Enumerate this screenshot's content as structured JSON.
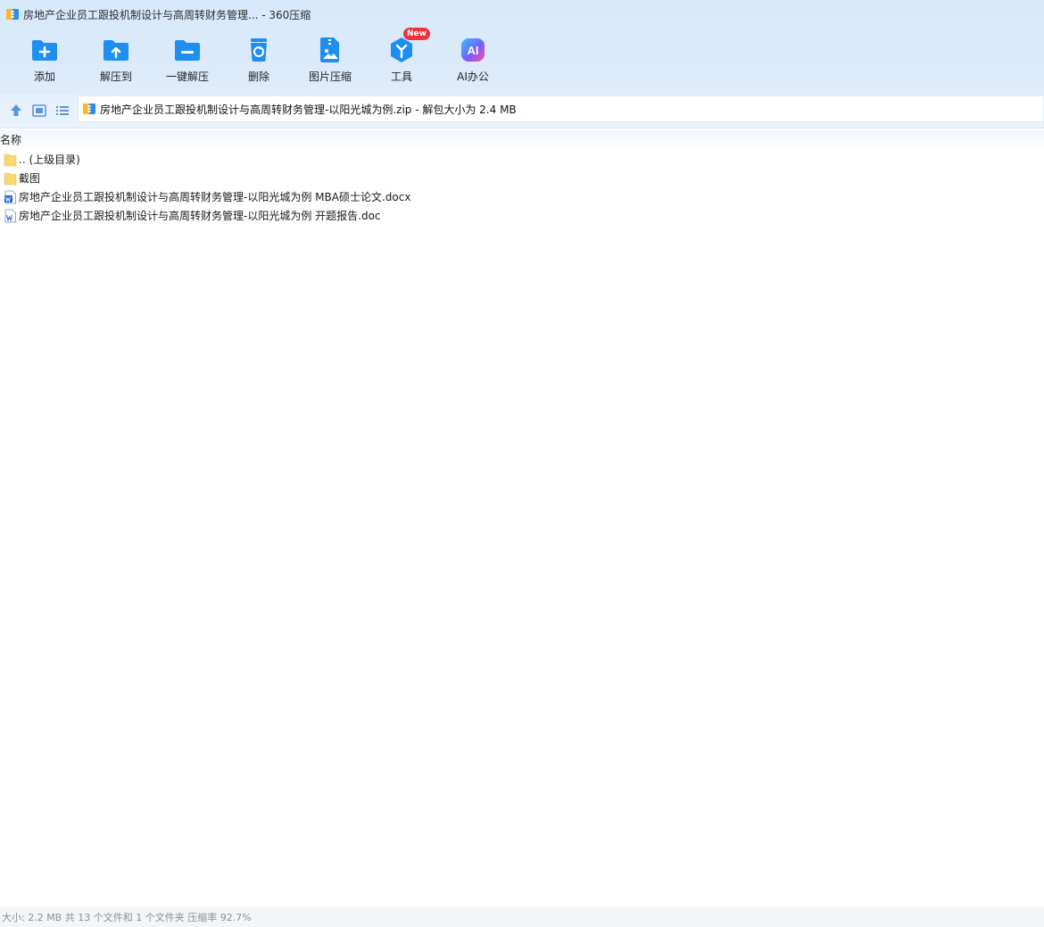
{
  "window": {
    "title": "房地产企业员工跟投机制设计与高周转财务管理... - 360压缩",
    "app_icon": "archive-app-icon"
  },
  "toolbar": {
    "items": [
      {
        "label": "添加",
        "icon": "add-icon"
      },
      {
        "label": "解压到",
        "icon": "extract-to-icon"
      },
      {
        "label": "一键解压",
        "icon": "one-click-extract-icon"
      },
      {
        "label": "删除",
        "icon": "delete-icon"
      },
      {
        "label": "图片压缩",
        "icon": "image-compress-icon"
      },
      {
        "label": "工具",
        "icon": "tools-icon",
        "badge": "New"
      },
      {
        "label": "AI办公",
        "icon": "ai-office-icon",
        "glyph": "AI"
      }
    ]
  },
  "address": {
    "path": "房地产企业员工跟投机制设计与高周转财务管理-以阳光城为例.zip - 解包大小为 2.4 MB",
    "nav_icons": [
      "up-arrow-icon",
      "thumbnail-view-icon",
      "list-view-icon"
    ]
  },
  "list": {
    "column_name": "名称",
    "rows": [
      {
        "name": ".. (上级目录)",
        "type": "folder"
      },
      {
        "name": "截图",
        "type": "folder"
      },
      {
        "name": "房地产企业员工跟投机制设计与高周转财务管理-以阳光城为例 MBA硕士论文.docx",
        "type": "word"
      },
      {
        "name": "房地产企业员工跟投机制设计与高周转财务管理-以阳光城为例 开题报告.doc",
        "type": "word"
      }
    ]
  },
  "status": {
    "text": "大小: 2.2 MB 共 13 个文件和 1 个文件夹 压缩率 92.7%"
  },
  "colors": {
    "toolbar_bg": "#d9eafb",
    "icon_blue": "#1e8ff0",
    "badge_red": "#f0313d",
    "folder_yellow": "#f8d776",
    "word_blue": "#2a5bd7",
    "status_text": "#8a8f96"
  }
}
